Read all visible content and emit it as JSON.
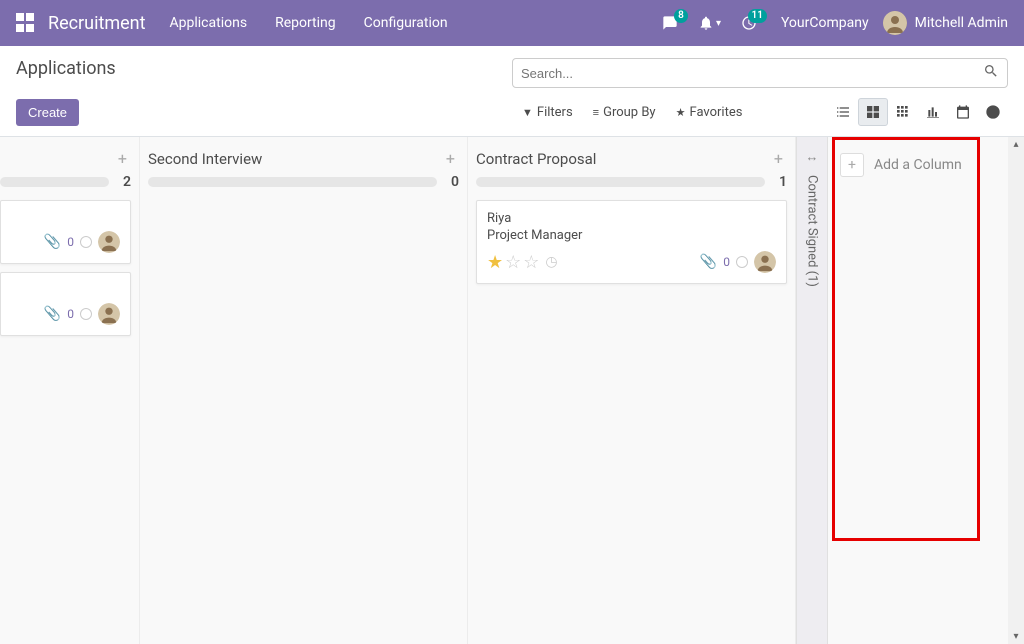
{
  "navbar": {
    "app_title": "Recruitment",
    "links": [
      "Applications",
      "Reporting",
      "Configuration"
    ],
    "messaging_badge": "8",
    "activities_badge": "11",
    "company": "YourCompany",
    "user": "Mitchell Admin"
  },
  "control_panel": {
    "title": "Applications",
    "create_label": "Create",
    "search_placeholder": "Search...",
    "filters_label": "Filters",
    "groupby_label": "Group By",
    "favorites_label": "Favorites"
  },
  "columns": {
    "col0": {
      "count": "2",
      "card0_attach": "0",
      "card1_attach": "0"
    },
    "col1": {
      "title": "Second Interview",
      "count": "0"
    },
    "col2": {
      "title": "Contract Proposal",
      "count": "1",
      "card": {
        "name": "Riya",
        "subtitle": "Project Manager",
        "attach": "0"
      }
    },
    "folded": {
      "label": "Contract Signed (1)"
    },
    "add_label": "Add a Column"
  }
}
